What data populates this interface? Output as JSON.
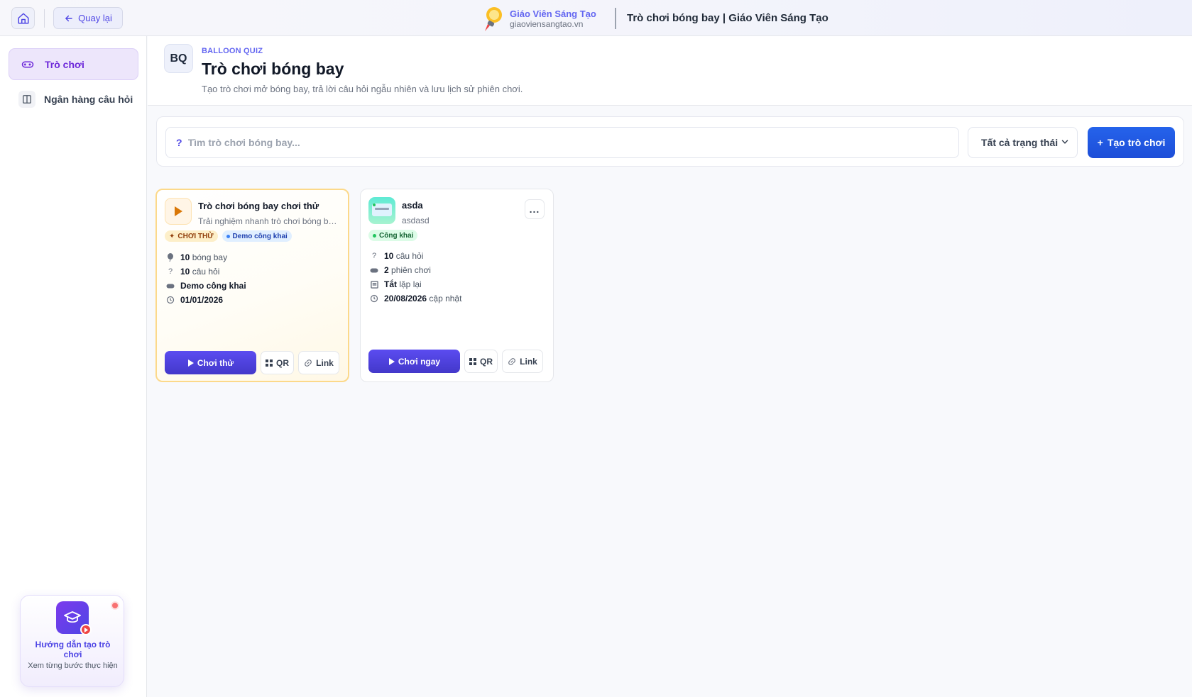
{
  "header": {
    "back_label": "Quay lại",
    "brand_name": "Giáo Viên Sáng Tạo",
    "brand_url": "giaoviensangtao.vn",
    "page_title": "Trò chơi bóng bay | Giáo Viên Sáng Tạo"
  },
  "sidebar": {
    "items": [
      {
        "label": "Trò chơi",
        "icon": "gamepad-icon",
        "active": true
      },
      {
        "label": "Ngân hàng câu hỏi",
        "icon": "book-icon",
        "active": false
      }
    ],
    "guide": {
      "title": "Hướng dẫn tạo trò chơi",
      "subtitle": "Xem từng bước thực hiện"
    }
  },
  "main": {
    "badge": "BQ",
    "kicker": "BALLOON QUIZ",
    "title": "Trò chơi bóng bay",
    "subtitle": "Tạo trò chơi mở bóng bay, trả lời câu hỏi ngẫu nhiên và lưu lịch sử phiên chơi."
  },
  "toolbar": {
    "search_icon": "?",
    "search_placeholder": "Tìm trò chơi bóng bay...",
    "status_filter": "Tất cả trạng thái",
    "create_label": "Tạo trò chơi",
    "create_plus": "+"
  },
  "cards": [
    {
      "title": "Trò chơi bóng bay chơi thử",
      "description": "Trải nghiệm nhanh trò chơi bóng bay trực tiếp",
      "badges": [
        "CHƠI THỬ",
        "Demo công khai"
      ],
      "stats": [
        {
          "value": "10",
          "label": "bóng bay"
        },
        {
          "value": "10",
          "label": "câu hỏi"
        },
        {
          "value": "Demo công khai",
          "label": ""
        },
        {
          "value": "01/01/2026",
          "label": ""
        }
      ],
      "primary_label": "Chơi thử",
      "qr_label": "QR",
      "link_label": "Link"
    },
    {
      "title": "asda",
      "description": "asdasd",
      "more_label": "...",
      "badges": [
        "Công khai"
      ],
      "stats": [
        {
          "value": "10",
          "label": "câu hỏi"
        },
        {
          "value": "2",
          "label": "phiên chơi"
        },
        {
          "value": "Tắt",
          "label": "lặp lại"
        },
        {
          "value": "20/08/2026",
          "label": "cập nhật"
        }
      ],
      "primary_label": "Chơi ngay",
      "qr_label": "QR",
      "link_label": "Link"
    }
  ],
  "colors": {
    "accent": "#4f46e5",
    "primary_button": "#1d4ed8",
    "demo_border": "#fcd98a"
  }
}
